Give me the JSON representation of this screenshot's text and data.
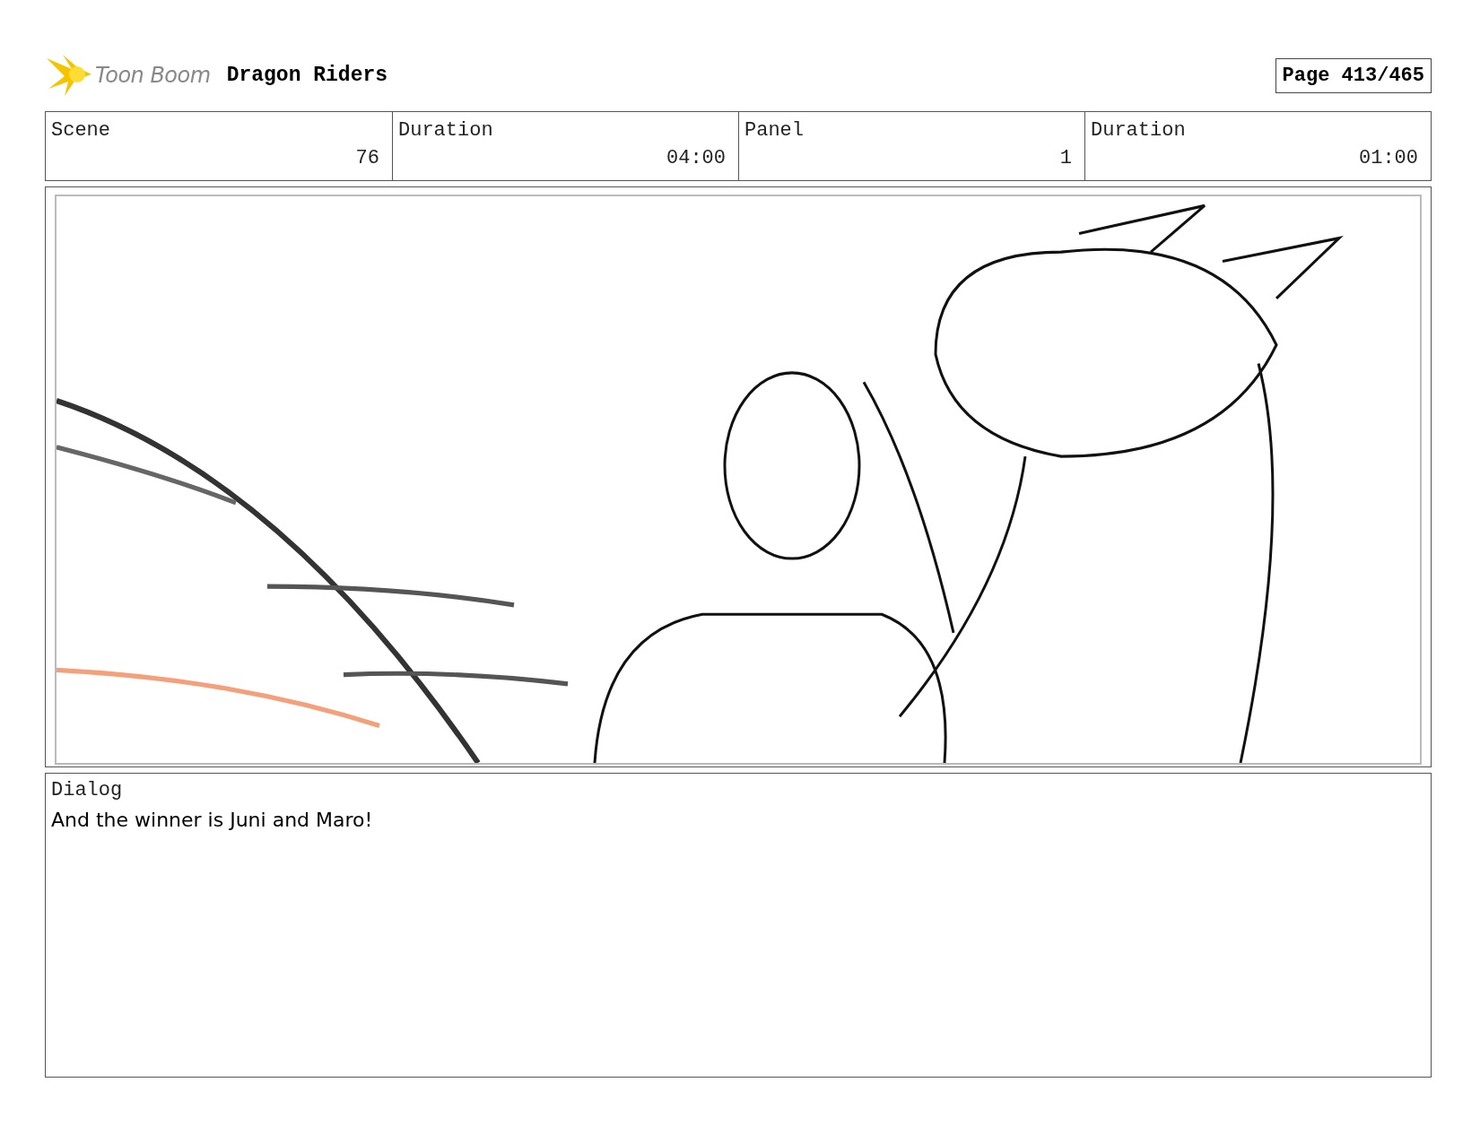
{
  "header": {
    "logo_text": "Toon Boom",
    "project_title": "Dragon Riders",
    "page": "Page 413/465"
  },
  "fields": [
    {
      "label": "Scene",
      "value": "76"
    },
    {
      "label": "Duration",
      "value": "04:00"
    },
    {
      "label": "Panel",
      "value": "1"
    },
    {
      "label": "Duration",
      "value": "01:00"
    }
  ],
  "dialog": {
    "label": "Dialog",
    "text": "And the winner is Juni and Maro!"
  }
}
